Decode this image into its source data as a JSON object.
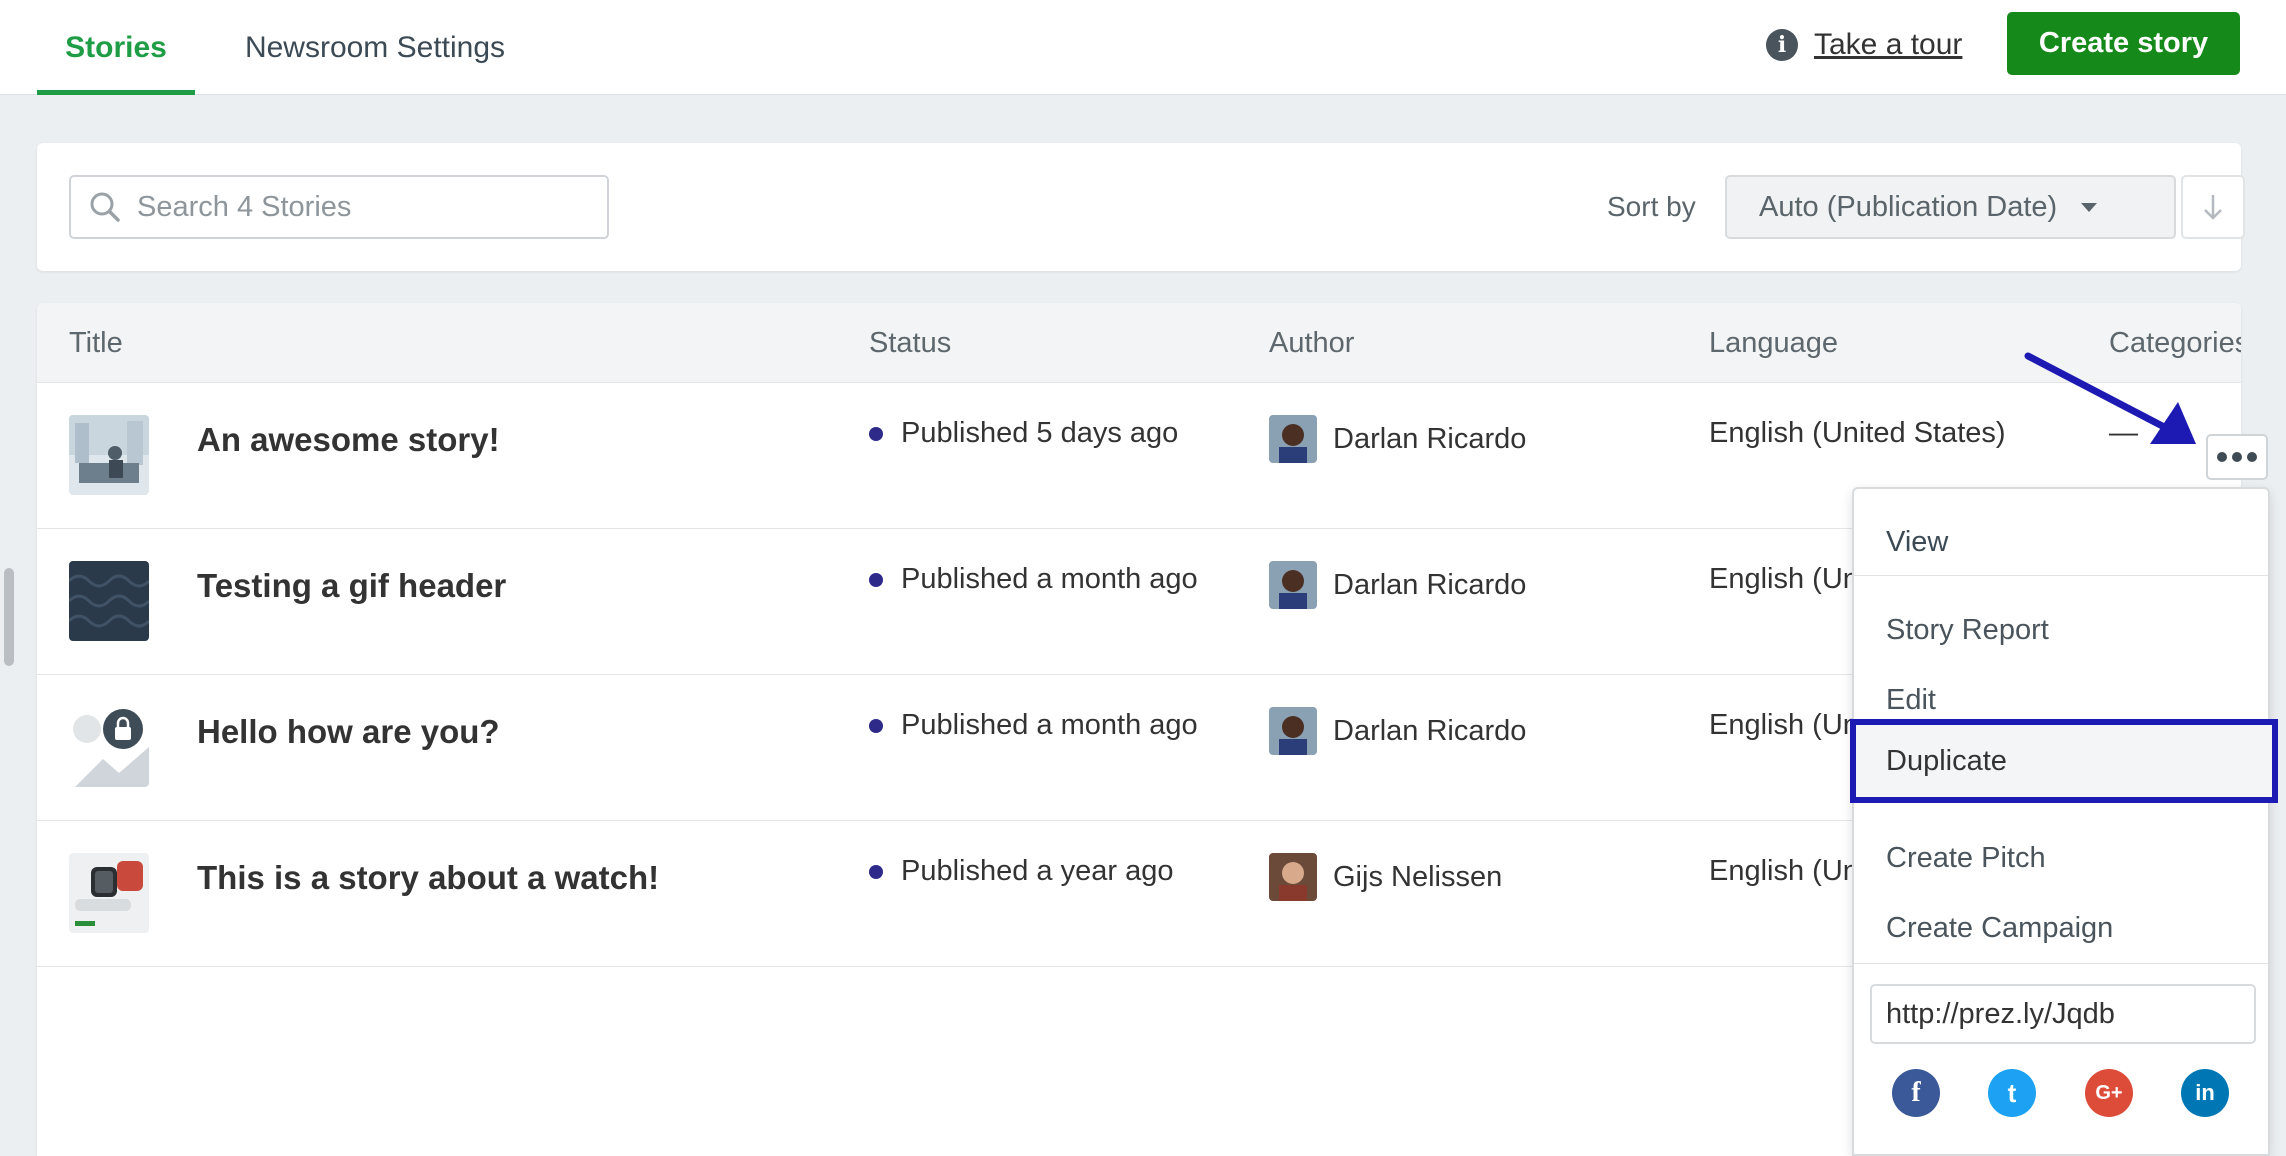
{
  "nav": {
    "tabs": [
      {
        "label": "Stories",
        "active": true
      },
      {
        "label": "Newsroom Settings",
        "active": false
      }
    ],
    "tour_label": "Take a tour",
    "create_label": "Create story"
  },
  "toolbar": {
    "search_placeholder": "Search 4 Stories",
    "sort_label": "Sort by",
    "sort_value": "Auto (Publication Date)"
  },
  "table": {
    "columns": [
      "Title",
      "Status",
      "Author",
      "Language",
      "Categories"
    ],
    "rows": [
      {
        "title": "An awesome story!",
        "status": "Published 5 days ago",
        "author": "Darlan Ricardo",
        "language": "English (United States)",
        "categories": "—"
      },
      {
        "title": "Testing a gif header",
        "status": "Published a month ago",
        "author": "Darlan Ricardo",
        "language": "English (United States)",
        "categories": ""
      },
      {
        "title": "Hello how are you?",
        "status": "Published a month ago",
        "author": "Darlan Ricardo",
        "language": "English (United States)",
        "categories": ""
      },
      {
        "title": "This is a story about a watch!",
        "status": "Published a year ago",
        "author": "Gijs Nelissen",
        "language": "English (United States)",
        "categories": ""
      }
    ]
  },
  "menu": {
    "items": [
      "View",
      "Story Report",
      "Edit",
      "Duplicate",
      "Create Pitch",
      "Create Campaign"
    ],
    "highlighted": "Duplicate",
    "short_url": "http://prez.ly/Jqdb",
    "share": [
      {
        "icon": "facebook-icon",
        "glyph": "f",
        "color": "#3b5998"
      },
      {
        "icon": "twitter-icon",
        "glyph": "t",
        "color": "#1da1f2"
      },
      {
        "icon": "google-plus-icon",
        "glyph": "G+",
        "color": "#dd4b39"
      },
      {
        "icon": "linkedin-icon",
        "glyph": "in",
        "color": "#0077b5"
      }
    ]
  },
  "colors": {
    "accent": "#1f9d46",
    "create_button": "#15891a",
    "status_dot": "#2e2a8a",
    "annotation": "#1d1ab3"
  }
}
